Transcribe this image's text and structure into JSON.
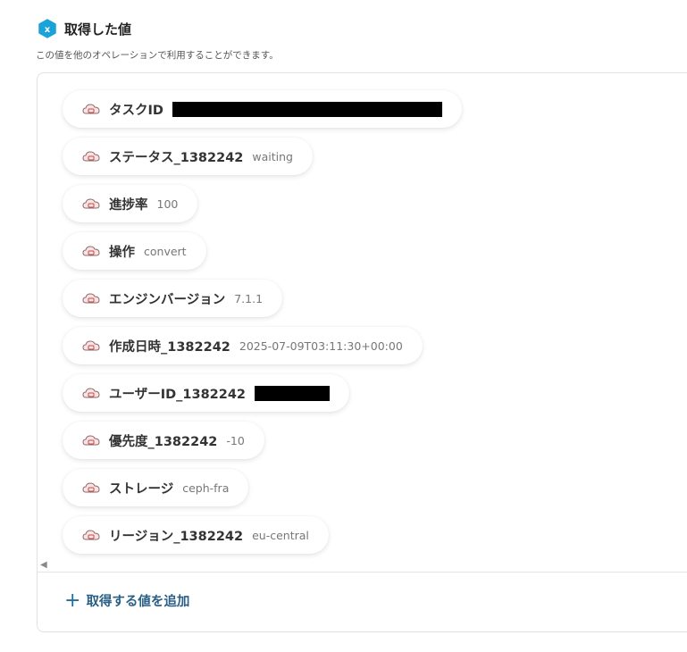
{
  "header": {
    "title": "取得した値",
    "icon": "hex-x-icon",
    "accent_color": "#19a3d9"
  },
  "description": "この値を他のオペレーションで利用することができます。",
  "items": [
    {
      "label": "タスクID",
      "value": "",
      "redacted": true
    },
    {
      "label": "ステータス_1382242",
      "value": "waiting",
      "redacted": false
    },
    {
      "label": "進捗率",
      "value": "100",
      "redacted": false
    },
    {
      "label": "操作",
      "value": "convert",
      "redacted": false
    },
    {
      "label": "エンジンバージョン",
      "value": "7.1.1",
      "redacted": false
    },
    {
      "label": "作成日時_1382242",
      "value": "2025-07-09T03:11:30+00:00",
      "redacted": false
    },
    {
      "label": "ユーザーID_1382242",
      "value": "",
      "redacted": true
    },
    {
      "label": "優先度_1382242",
      "value": "-10",
      "redacted": false
    },
    {
      "label": "ストレージ",
      "value": "ceph-fra",
      "redacted": false
    },
    {
      "label": "リージョン_1382242",
      "value": "eu-central",
      "redacted": false
    }
  ],
  "item_icon": "cloud-icon",
  "add_button": {
    "label": "取得する値を追加",
    "icon": "plus-icon"
  }
}
